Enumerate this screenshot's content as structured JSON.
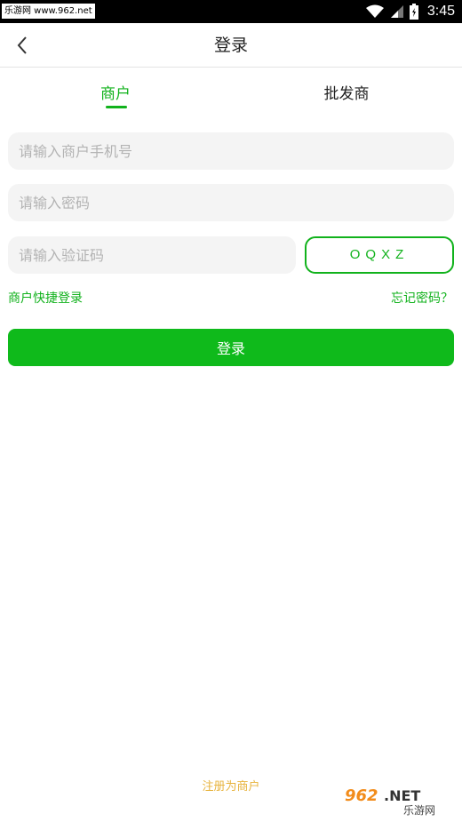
{
  "status_bar": {
    "watermark": "乐游网 www.962.net",
    "time": "3:45",
    "icons": [
      "wifi-icon",
      "signal-icon",
      "battery-icon"
    ]
  },
  "nav": {
    "title": "登录",
    "back_icon": "chevron-left-icon"
  },
  "tabs": [
    {
      "label": "商户",
      "active": true
    },
    {
      "label": "批发商",
      "active": false
    }
  ],
  "form": {
    "phone_placeholder": "请输入商户手机号",
    "password_placeholder": "请输入密码",
    "code_placeholder": "请输入验证码",
    "captcha_text": "OQXZ"
  },
  "links": {
    "quick_login": "商户快捷登录",
    "forgot_password": "忘记密码？"
  },
  "login_button": "登录",
  "register": "注册为商户",
  "corner_logo": {
    "text": "962.NET",
    "subtext": "乐游网"
  },
  "colors": {
    "accent": "#11b21c",
    "button": "#0fba1b",
    "register": "#e7b33d",
    "input_bg": "#f4f4f4"
  }
}
